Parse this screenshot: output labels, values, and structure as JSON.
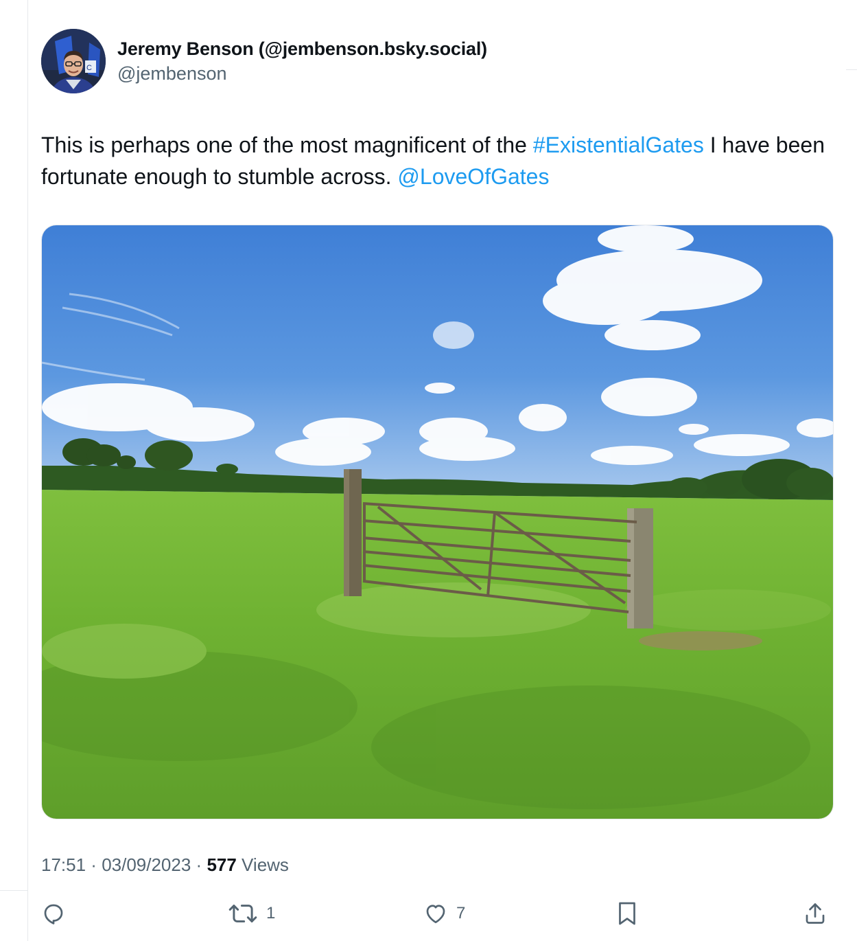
{
  "author": {
    "display_name": "Jeremy Benson (@jembenson.bsky.social)",
    "handle": "@jembenson"
  },
  "tweet": {
    "text_part1": "This is perhaps one of the most magnificent of the ",
    "hashtag": "#ExistentialGates",
    "text_part2": " I have been fortunate enough to stumble across. ",
    "mention": "@LoveOfGates"
  },
  "meta": {
    "time": "17:51",
    "separator1": " · ",
    "date": "03/09/2023",
    "separator2": " · ",
    "views_count": "577",
    "views_label": " Views"
  },
  "actions": {
    "reply_icon": "reply-icon",
    "retweet_icon": "retweet-icon",
    "retweet_count": "1",
    "like_icon": "heart-icon",
    "like_count": "7",
    "bookmark_icon": "bookmark-icon",
    "share_icon": "share-icon"
  },
  "colors": {
    "link": "#1d9bf0",
    "secondary_text": "#536471",
    "primary_text": "#0f1419"
  }
}
